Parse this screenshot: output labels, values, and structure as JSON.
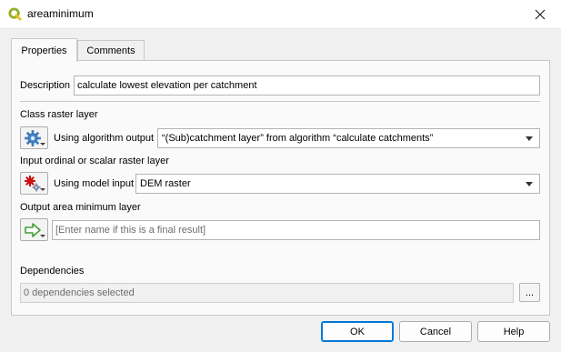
{
  "window": {
    "title": "areaminimum",
    "close_icon": "close-icon",
    "app_icon": "qgis-icon"
  },
  "tabs": [
    {
      "label": "Properties",
      "active": true
    },
    {
      "label": "Comments",
      "active": false
    }
  ],
  "description": {
    "label": "Description",
    "value": "calculate lowest elevation per catchment"
  },
  "class_raster": {
    "label": "Class raster layer",
    "source_label": "Using algorithm output",
    "selected": "“(Sub)catchment layer” from algorithm “calculate catchments”",
    "icon": "algorithm-gear-icon"
  },
  "input_raster": {
    "label": "Input ordinal or scalar raster layer",
    "source_label": "Using model input",
    "selected": "DEM raster",
    "icon": "model-input-icon"
  },
  "output": {
    "label": "Output area minimum layer",
    "placeholder": "[Enter name if this is a final result]",
    "icon": "model-output-arrow-icon"
  },
  "dependencies": {
    "label": "Dependencies",
    "value": "0 dependencies selected",
    "browse_label": "..."
  },
  "buttons": {
    "ok": "OK",
    "cancel": "Cancel",
    "help": "Help"
  },
  "colors": {
    "accent": "#0078d7",
    "qgis_green": "#93b023",
    "gear_blue": "#4a8cd2",
    "gear_red": "#cc1111",
    "arrow_green": "#3f9e3a"
  }
}
